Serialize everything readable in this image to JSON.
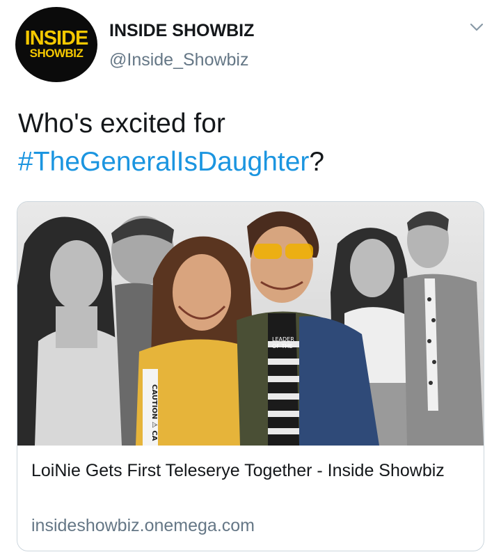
{
  "author": {
    "avatar_line1": "INSIDE",
    "avatar_line2": "SHOWBIZ",
    "display_name": "INSIDE SHOWBIZ",
    "handle": "@Inside_Showbiz"
  },
  "tweet": {
    "text_before": "Who's excited for ",
    "hashtag": "#TheGeneralIsDaughter",
    "text_after": "?"
  },
  "card": {
    "image_icon": "photo-of-five-actors",
    "shirt_text_1": "LEADER",
    "shirt_text_2": "OF THE",
    "tape_text": "CAUTION ⚠ CA",
    "title": "LoiNie Gets First Teleserye Together - Inside Showbiz",
    "domain": "insideshowbiz.onemega.com"
  },
  "colors": {
    "text": "#14171a",
    "secondary": "#657786",
    "link": "#1b95e0",
    "card_border": "#ccd6dd",
    "avatar_bg": "#0b0b0b",
    "avatar_text": "#f5c800"
  },
  "icons": {
    "caret": "chevron-down-icon"
  }
}
